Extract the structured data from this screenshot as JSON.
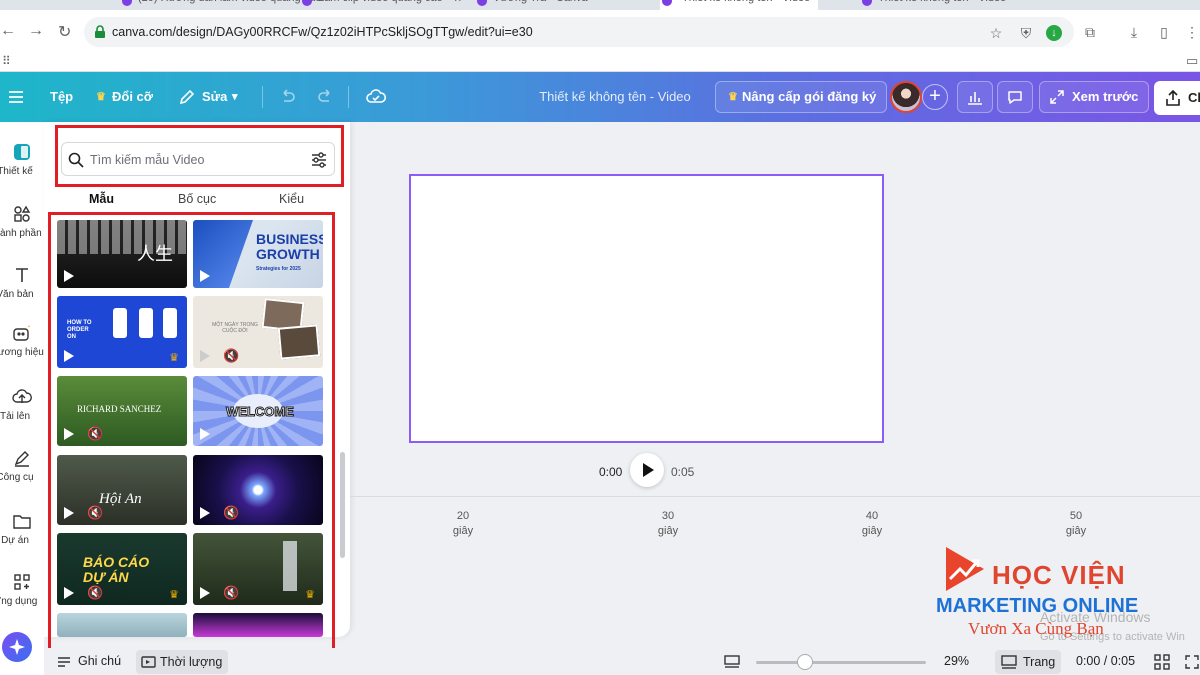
{
  "browser": {
    "tabs": [
      "(20) Hướng dẫn làm video quảng cáo",
      "Làm clip video quảng cáo - Tr",
      "Vương Trà - Canva",
      "Thiết kế không tên - Video",
      "Thiết kế không tên - Video"
    ],
    "url": "canva.com/design/DAGy00RRCFw/Qz1z02iHTPcSkljSOgTTgw/edit?ui=e30"
  },
  "toolbar": {
    "file_label": "Tệp",
    "resize_label": "Đổi cỡ",
    "edit_label": "Sửa",
    "design_title": "Thiết kế không tên - Video",
    "upgrade_label": "Nâng cấp gói đăng ký",
    "preview_label": "Xem trước",
    "share_label": "Ch"
  },
  "rail": {
    "items": [
      {
        "label": "Thiết kế",
        "icon": "design-icon"
      },
      {
        "label": "Thành phần",
        "icon": "elements-icon"
      },
      {
        "label": "Văn bản",
        "icon": "text-icon"
      },
      {
        "label": "Thương hiệu",
        "icon": "brand-icon"
      },
      {
        "label": "Tải lên",
        "icon": "upload-icon"
      },
      {
        "label": "Công cụ",
        "icon": "tools-icon"
      },
      {
        "label": "Dự án",
        "icon": "folder-icon"
      },
      {
        "label": "Ứng dụng",
        "icon": "apps-icon"
      }
    ]
  },
  "panel": {
    "search_placeholder": "Tìm kiếm mẫu Video",
    "tabs": [
      "Mẫu",
      "Bố cục",
      "Kiểu"
    ],
    "active_tab": "Mẫu",
    "templates": [
      {
        "text": "人生"
      },
      {
        "text": "BUSINESS GROWTH",
        "sub": "Strategies for 2025"
      },
      {
        "text": "HOW TO ORDER ON"
      },
      {
        "text": "MỘT NGÀY TRONG CUỘC ĐỜI"
      },
      {
        "text": "RICHARD SANCHEZ"
      },
      {
        "text": "WELCOME"
      },
      {
        "text": "Hội An"
      },
      {
        "text": ""
      },
      {
        "text": "BÁO CÁO DỰ ÁN"
      },
      {
        "text": ""
      }
    ]
  },
  "player": {
    "current_time": "0:00",
    "duration": "0:05"
  },
  "timeline": {
    "ticks": [
      {
        "value": "20",
        "unit": "giây"
      },
      {
        "value": "30",
        "unit": "giây"
      },
      {
        "value": "40",
        "unit": "giây"
      },
      {
        "value": "50",
        "unit": "giây"
      }
    ]
  },
  "bottom": {
    "notes_label": "Ghi chú",
    "duration_label": "Thời lượng",
    "zoom": "29%",
    "zoom_fraction": 0.29,
    "pages_label": "Trang",
    "time_readout": "0:00 / 0:05"
  },
  "watermark": {
    "line1": "HỌC VIỆN",
    "line2": "MARKETING ONLINE",
    "line3": "Vươn Xa Cùng Bạn",
    "activate1": "Activate Windows",
    "activate2": "Go to Settings to activate Win"
  },
  "colors": {
    "accent_purple": "#8b5cf6",
    "highlight_red": "#e01e26",
    "toolbar_start": "#1eb6c9",
    "toolbar_end": "#7a55e6"
  }
}
